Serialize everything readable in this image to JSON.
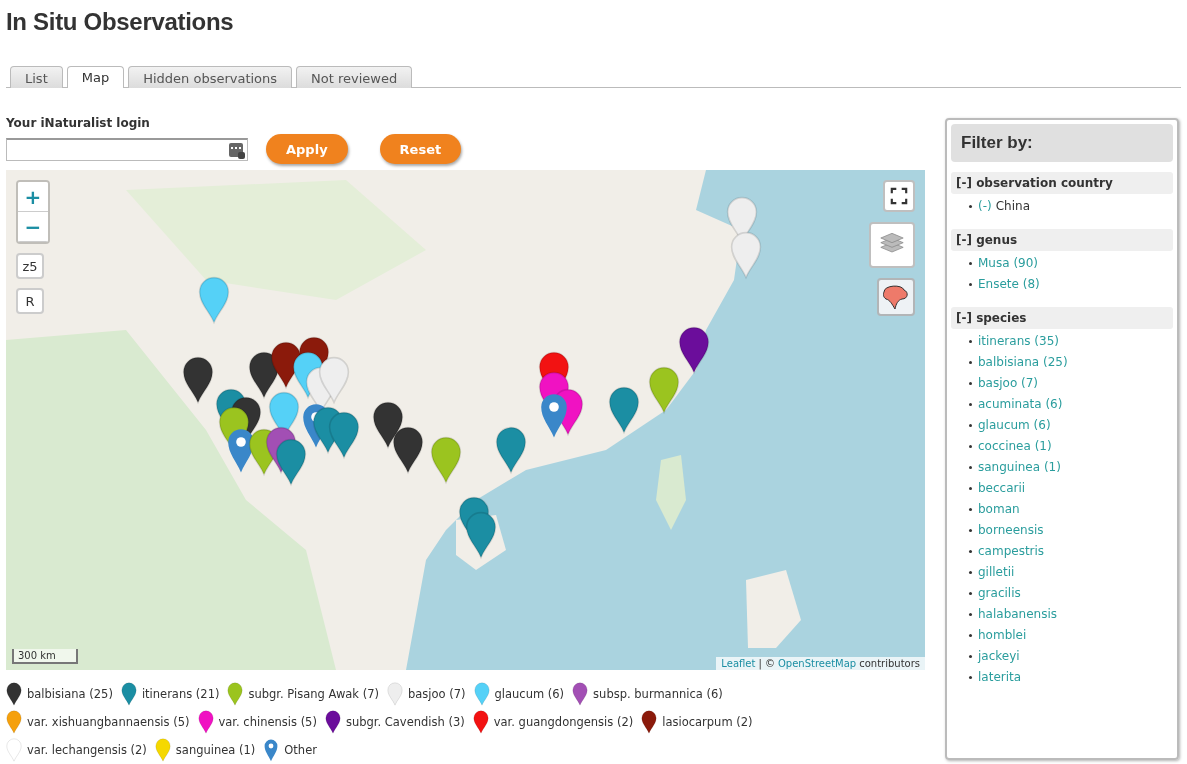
{
  "page_title": "In Situ Observations",
  "tabs": [
    {
      "label": "List",
      "selected": false
    },
    {
      "label": "Map",
      "selected": true
    },
    {
      "label": "Hidden observations",
      "selected": false
    },
    {
      "label": "Not reviewed",
      "selected": false
    }
  ],
  "login": {
    "label": "Your iNaturalist login",
    "buttons": [
      "Apply",
      "Reset"
    ]
  },
  "map": {
    "controls_left": [
      "+",
      "−",
      "z5",
      "R"
    ],
    "scale": "300 km",
    "attribution": {
      "leaflet": "Leaflet",
      "separator": "| ©",
      "osm": "OpenStreetMap",
      "suffix": "contributors"
    }
  },
  "legend": [
    {
      "label": "balbisiana (25)",
      "color": "#333333",
      "kind": "pin"
    },
    {
      "label": "itinerans (21)",
      "color": "#1b8ea3",
      "kind": "pin"
    },
    {
      "label": "subgr. Pisang Awak (7)",
      "color": "#9bc41f",
      "kind": "pin"
    },
    {
      "label": "basjoo (7)",
      "color": "#eeeeee",
      "kind": "pin"
    },
    {
      "label": "glaucum (6)",
      "color": "#55d1f7",
      "kind": "pin"
    },
    {
      "label": "subsp. burmannica (6)",
      "color": "#a24fb4",
      "kind": "pin"
    },
    {
      "label": "var. xishuangbannaensis (5)",
      "color": "#f5a00c",
      "kind": "pin"
    },
    {
      "label": "var. chinensis (5)",
      "color": "#f012c2",
      "kind": "pin"
    },
    {
      "label": "subgr. Cavendish (3)",
      "color": "#6b0d9b",
      "kind": "pin"
    },
    {
      "label": "var. guangdongensis (2)",
      "color": "#f21212",
      "kind": "pin"
    },
    {
      "label": "lasiocarpum (2)",
      "color": "#8b1a0b",
      "kind": "pin"
    },
    {
      "label": "var. lechangensis (2)",
      "color": "#ffffff",
      "kind": "pin"
    },
    {
      "label": "sanguinea (1)",
      "color": "#f5d800",
      "kind": "pin"
    },
    {
      "label": "Other",
      "color": "#3a87c9",
      "kind": "marker"
    }
  ],
  "filter": {
    "title": "Filter by:",
    "sections": [
      {
        "heading": "[-] observation country",
        "items": [
          {
            "link": "(-)",
            "text": "China"
          }
        ]
      },
      {
        "heading": "[-] genus",
        "items": [
          {
            "link": "Musa (90)"
          },
          {
            "link": "Ensete (8)"
          }
        ]
      },
      {
        "heading": "[-] species",
        "items": [
          {
            "link": "itinerans (35)"
          },
          {
            "link": "balbisiana (25)"
          },
          {
            "link": "basjoo (7)"
          },
          {
            "link": "acuminata (6)"
          },
          {
            "link": "glaucum (6)"
          },
          {
            "link": "coccinea (1)"
          },
          {
            "link": "sanguinea (1)"
          },
          {
            "link": "beccarii"
          },
          {
            "link": "boman"
          },
          {
            "link": "borneensis"
          },
          {
            "link": "campestris"
          },
          {
            "link": "gilletii"
          },
          {
            "link": "gracilis"
          },
          {
            "link": "halabanensis"
          },
          {
            "link": "homblei"
          },
          {
            "link": "jackeyi"
          },
          {
            "link": "laterita"
          }
        ]
      }
    ]
  }
}
